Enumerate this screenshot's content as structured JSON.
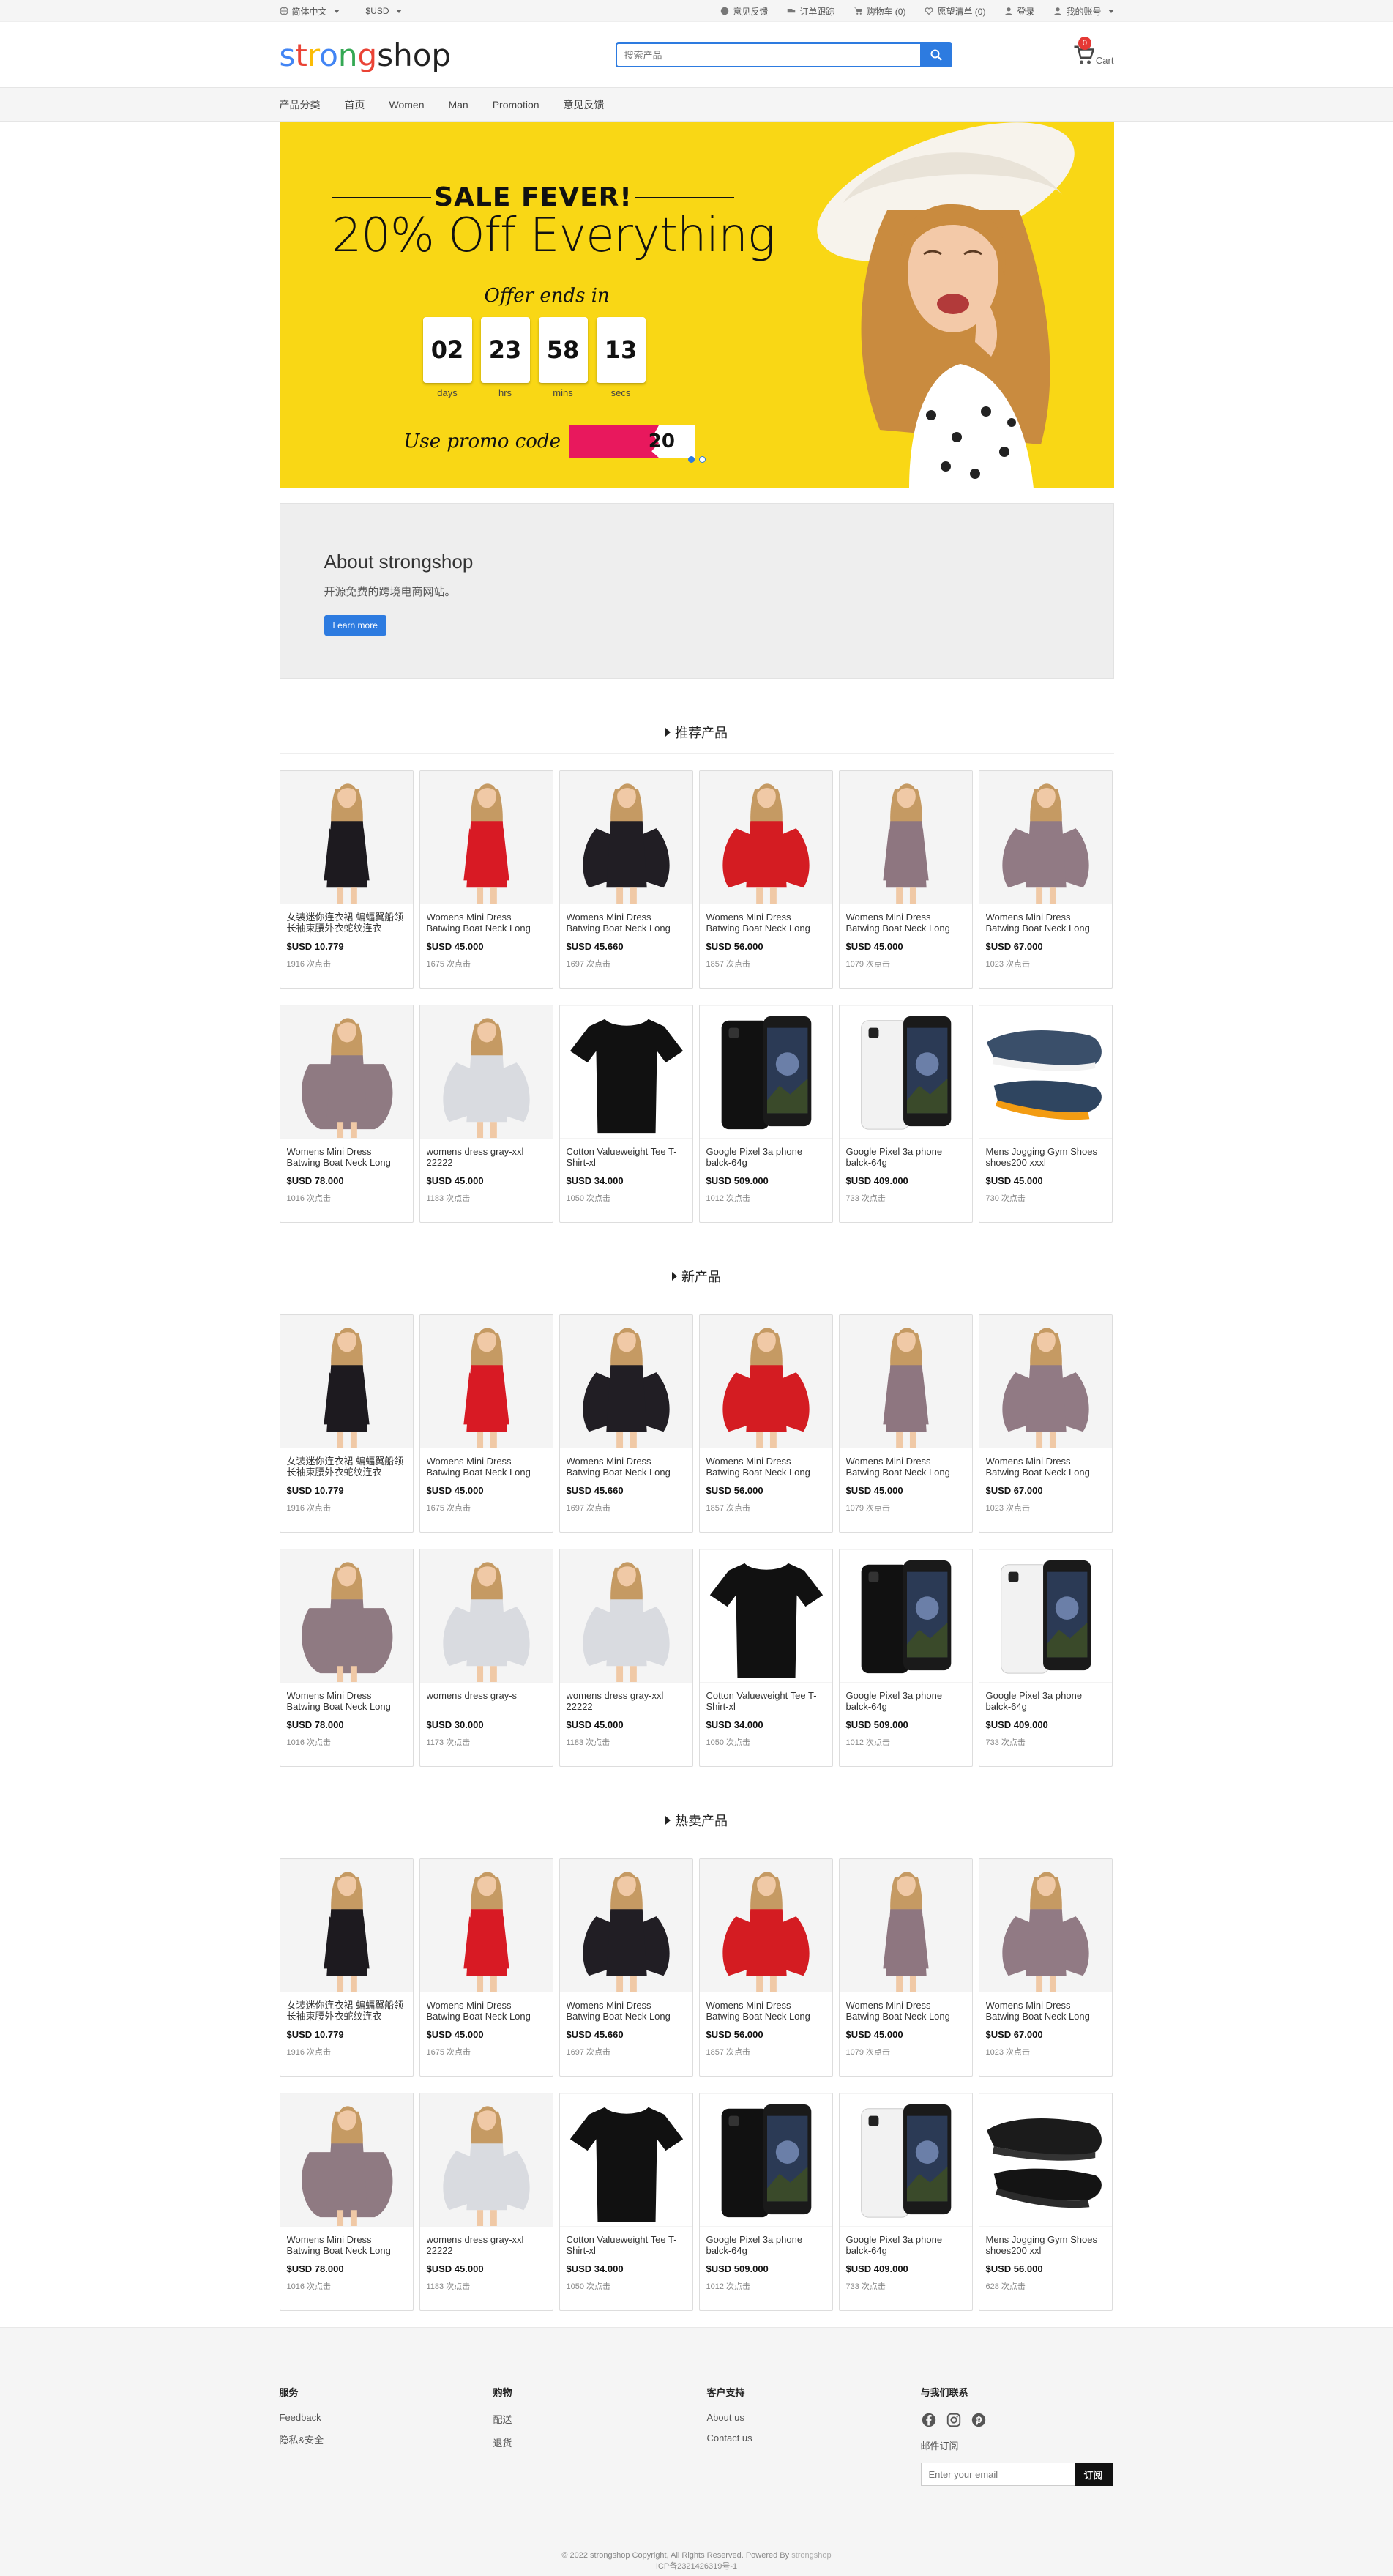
{
  "topbar": {
    "language": "简体中文",
    "currency": "$USD",
    "links": [
      "意见反馈",
      "订单跟踪",
      "购物车 (0)",
      "愿望清单 (0)",
      "登录",
      "我的账号"
    ]
  },
  "header": {
    "logo": {
      "s": "s",
      "t": "t",
      "r": "r",
      "o": "o",
      "n": "n",
      "g": "g",
      "shop": "shop"
    },
    "search_placeholder": "搜索产品",
    "cart_count": "0",
    "cart_label": "Cart"
  },
  "nav": [
    "产品分类",
    "首页",
    "Women",
    "Man",
    "Promotion",
    "意见反馈"
  ],
  "banner": {
    "sale": "SALE FEVER!",
    "headline": "20% Off Everything",
    "offer": "Offer ends in",
    "countdown": [
      {
        "value": "02",
        "label": "days"
      },
      {
        "value": "23",
        "label": "hrs"
      },
      {
        "value": "58",
        "label": "mins"
      },
      {
        "value": "13",
        "label": "secs"
      }
    ],
    "promo_text": "Use promo code",
    "promo_code_visible": "20",
    "slides": 2,
    "active_slide": 1
  },
  "about": {
    "title": "About strongshop",
    "desc": "开源免费的跨境电商网站。",
    "button": "Learn more"
  },
  "colors": {
    "accent": "#2d7be0",
    "banner_bg": "#f9d715",
    "promo_mask": "#e8185d",
    "badge": "#e53935"
  },
  "sections": [
    {
      "title": "推荐产品",
      "products": [
        {
          "name": "女装迷你连衣裙 蝙蝠翼船领长袖束腰外衣蛇纹连衣",
          "price": "$USD 10.779",
          "clicks": "1916 次点击",
          "img": "dress-black"
        },
        {
          "name": "Womens Mini Dress Batwing Boat Neck Long",
          "price": "$USD 45.000",
          "clicks": "1675 次点击",
          "img": "dress-red"
        },
        {
          "name": "Womens Mini Dress Batwing Boat Neck Long",
          "price": "$USD 45.660",
          "clicks": "1697 次点击",
          "img": "dress-black-wide"
        },
        {
          "name": "Womens Mini Dress Batwing Boat Neck Long",
          "price": "$USD 56.000",
          "clicks": "1857 次点击",
          "img": "dress-red-wide"
        },
        {
          "name": "Womens Mini Dress Batwing Boat Neck Long",
          "price": "$USD 45.000",
          "clicks": "1079 次点击",
          "img": "dress-mauve"
        },
        {
          "name": "Womens Mini Dress Batwing Boat Neck Long",
          "price": "$USD 67.000",
          "clicks": "1023 次点击",
          "img": "dress-mauve-wide"
        },
        {
          "name": "Womens Mini Dress Batwing Boat Neck Long",
          "price": "$USD 78.000",
          "clicks": "1016 次点击",
          "img": "dress-mauve-back"
        },
        {
          "name": "womens dress gray-xxl 22222",
          "price": "$USD 45.000",
          "clicks": "1183 次点击",
          "img": "dress-gray"
        },
        {
          "name": "Cotton Valueweight Tee T-Shirt-xl",
          "price": "$USD 34.000",
          "clicks": "1050 次点击",
          "img": "tshirt"
        },
        {
          "name": "Google Pixel 3a phone balck-64g",
          "price": "$USD 509.000",
          "clicks": "1012 次点击",
          "img": "phone-black"
        },
        {
          "name": "Google Pixel 3a phone balck-64g",
          "price": "$USD 409.000",
          "clicks": "733 次点击",
          "img": "phone-white"
        },
        {
          "name": "Mens Jogging Gym Shoes shoes200 xxxl",
          "price": "$USD 45.000",
          "clicks": "730 次点击",
          "img": "shoes-blue"
        }
      ]
    },
    {
      "title": "新产品",
      "products": [
        {
          "name": "女装迷你连衣裙 蝙蝠翼船领长袖束腰外衣蛇纹连衣",
          "price": "$USD 10.779",
          "clicks": "1916 次点击",
          "img": "dress-black"
        },
        {
          "name": "Womens Mini Dress Batwing Boat Neck Long",
          "price": "$USD 45.000",
          "clicks": "1675 次点击",
          "img": "dress-red"
        },
        {
          "name": "Womens Mini Dress Batwing Boat Neck Long",
          "price": "$USD 45.660",
          "clicks": "1697 次点击",
          "img": "dress-black-wide"
        },
        {
          "name": "Womens Mini Dress Batwing Boat Neck Long",
          "price": "$USD 56.000",
          "clicks": "1857 次点击",
          "img": "dress-red-wide"
        },
        {
          "name": "Womens Mini Dress Batwing Boat Neck Long",
          "price": "$USD 45.000",
          "clicks": "1079 次点击",
          "img": "dress-mauve"
        },
        {
          "name": "Womens Mini Dress Batwing Boat Neck Long",
          "price": "$USD 67.000",
          "clicks": "1023 次点击",
          "img": "dress-mauve-wide"
        },
        {
          "name": "Womens Mini Dress Batwing Boat Neck Long",
          "price": "$USD 78.000",
          "clicks": "1016 次点击",
          "img": "dress-mauve-back"
        },
        {
          "name": "womens dress gray-s",
          "price": "$USD 30.000",
          "clicks": "1173 次点击",
          "img": "dress-gray"
        },
        {
          "name": "womens dress gray-xxl 22222",
          "price": "$USD 45.000",
          "clicks": "1183 次点击",
          "img": "dress-gray"
        },
        {
          "name": "Cotton Valueweight Tee T-Shirt-xl",
          "price": "$USD 34.000",
          "clicks": "1050 次点击",
          "img": "tshirt"
        },
        {
          "name": "Google Pixel 3a phone balck-64g",
          "price": "$USD 509.000",
          "clicks": "1012 次点击",
          "img": "phone-black"
        },
        {
          "name": "Google Pixel 3a phone balck-64g",
          "price": "$USD 409.000",
          "clicks": "733 次点击",
          "img": "phone-white"
        }
      ]
    },
    {
      "title": "热卖产品",
      "products": [
        {
          "name": "女装迷你连衣裙 蝙蝠翼船领长袖束腰外衣蛇纹连衣",
          "price": "$USD 10.779",
          "clicks": "1916 次点击",
          "img": "dress-black"
        },
        {
          "name": "Womens Mini Dress Batwing Boat Neck Long",
          "price": "$USD 45.000",
          "clicks": "1675 次点击",
          "img": "dress-red"
        },
        {
          "name": "Womens Mini Dress Batwing Boat Neck Long",
          "price": "$USD 45.660",
          "clicks": "1697 次点击",
          "img": "dress-black-wide"
        },
        {
          "name": "Womens Mini Dress Batwing Boat Neck Long",
          "price": "$USD 56.000",
          "clicks": "1857 次点击",
          "img": "dress-red-wide"
        },
        {
          "name": "Womens Mini Dress Batwing Boat Neck Long",
          "price": "$USD 45.000",
          "clicks": "1079 次点击",
          "img": "dress-mauve"
        },
        {
          "name": "Womens Mini Dress Batwing Boat Neck Long",
          "price": "$USD 67.000",
          "clicks": "1023 次点击",
          "img": "dress-mauve-wide"
        },
        {
          "name": "Womens Mini Dress Batwing Boat Neck Long",
          "price": "$USD 78.000",
          "clicks": "1016 次点击",
          "img": "dress-mauve-back"
        },
        {
          "name": "womens dress gray-xxl 22222",
          "price": "$USD 45.000",
          "clicks": "1183 次点击",
          "img": "dress-gray"
        },
        {
          "name": "Cotton Valueweight Tee T-Shirt-xl",
          "price": "$USD 34.000",
          "clicks": "1050 次点击",
          "img": "tshirt"
        },
        {
          "name": "Google Pixel 3a phone balck-64g",
          "price": "$USD 509.000",
          "clicks": "1012 次点击",
          "img": "phone-black"
        },
        {
          "name": "Google Pixel 3a phone balck-64g",
          "price": "$USD 409.000",
          "clicks": "733 次点击",
          "img": "phone-white"
        },
        {
          "name": "Mens Jogging Gym Shoes shoes200 xxl",
          "price": "$USD 56.000",
          "clicks": "628 次点击",
          "img": "shoes-black"
        }
      ]
    }
  ],
  "footer": {
    "cols": [
      {
        "title": "服务",
        "links": [
          "Feedback",
          "隐私&安全"
        ]
      },
      {
        "title": "购物",
        "links": [
          "配送",
          "退货"
        ]
      },
      {
        "title": "客户支持",
        "links": [
          "About us",
          "Contact us"
        ]
      }
    ],
    "contact_title": "与我们联系",
    "social_icons": [
      "facebook-icon",
      "instagram-icon",
      "pinterest-icon"
    ],
    "subscribe_label": "邮件订阅",
    "email_placeholder": "Enter your email",
    "subscribe_button": "订阅",
    "copyright": "© 2022 strongshop Copyright, All Rights Reserved. Powered By",
    "powered": "strongshop",
    "icp": "ICP备2321426319号-1"
  }
}
